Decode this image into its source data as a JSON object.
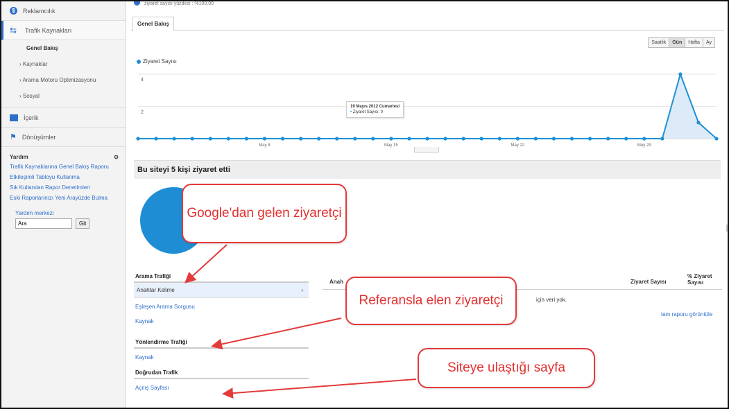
{
  "sidebar": {
    "items": [
      {
        "label": "Reklamcılık",
        "icon": "dollar-icon"
      },
      {
        "label": "Trafik Kaynakları",
        "icon": "traffic-arrows-icon"
      }
    ],
    "subitems": [
      "Genel Bakış",
      "› Kaynaklar",
      "› Arama Motoru Optimizasyonu",
      "› Sosyal"
    ],
    "items2": [
      {
        "label": "İçerik",
        "icon": "content-icon"
      },
      {
        "label": "Dönüşümler",
        "icon": "flag-icon"
      }
    ],
    "help": {
      "title": "Yardım",
      "toggle": "⊖",
      "links": [
        "Trafik Kaynaklarına Genel Bakış Raporu",
        "Etkileşimli Tabloyu Kullanma",
        "Sık Kullanılan Rapor Denetimleri",
        "Eski Raporlarınızı Yeni Arayüzde Bulma"
      ],
      "center_label": "Yardım merkezi",
      "search_value": "Ara",
      "go_label": "Git"
    }
  },
  "main": {
    "top_line": "ziyaret sayısı yüzdesi : %100,00",
    "tab": "Genel Bakış",
    "ranges": [
      "Saatlik",
      "Gün",
      "Hafta",
      "Ay"
    ],
    "selected_range": "Gün",
    "visitors_text": "Bu siteyi 5 kişi ziyaret etti",
    "tooltip": {
      "title": "19 Mayıs 2012 Cumartesi",
      "bullet": "•",
      "value": "Ziyaret Sayısı: 0"
    },
    "sections": {
      "search": {
        "title": "Arama Trafiği",
        "selected": "Anahtar Kelime",
        "chevron": "›",
        "links": [
          "Eşleşen Arama Sorgusu",
          "Kaynak"
        ]
      },
      "referral": {
        "title": "Yönlendirme Trafiği",
        "links": [
          "Kaynak"
        ]
      },
      "direct": {
        "title": "Doğrudan Trafik",
        "links": [
          "Açılış Sayfası"
        ]
      }
    },
    "table": {
      "col1": "Anah",
      "col2": "Ziyaret Sayısı",
      "col3": "% Ziyaret Sayısı",
      "no_data": "için veri yok.",
      "full_report": "tam raporu görüntüle"
    }
  },
  "callouts": {
    "google": "Google'dan gelen ziyaretçi",
    "referral": "Referansla elen ziyaretçi",
    "landing": "Siteye ulaştığı sayfa"
  },
  "colors": {
    "series": "#1d8fd6",
    "fill": "#dcebf7",
    "accent": "#2f6fc9",
    "callout": "#e33a3a"
  },
  "chart_data": {
    "type": "line",
    "legend": [
      "Ziyaret Sayısı"
    ],
    "ytick_labels": [
      "4",
      "2"
    ],
    "ylim": [
      0,
      4
    ],
    "xtick_labels": [
      "May 8",
      "May 15",
      "May 22",
      "May 29"
    ],
    "x": [
      "May 1",
      "May 2",
      "May 3",
      "May 4",
      "May 5",
      "May 6",
      "May 7",
      "May 8",
      "May 9",
      "May 10",
      "May 11",
      "May 12",
      "May 13",
      "May 14",
      "May 15",
      "May 16",
      "May 17",
      "May 18",
      "May 19",
      "May 20",
      "May 21",
      "May 22",
      "May 23",
      "May 24",
      "May 25",
      "May 26",
      "May 27",
      "May 28",
      "May 29",
      "May 30",
      "May 31",
      "Jun 1",
      "Jun 2"
    ],
    "series": [
      {
        "name": "Ziyaret Sayısı",
        "values": [
          0,
          0,
          0,
          0,
          0,
          0,
          0,
          0,
          0,
          0,
          0,
          0,
          0,
          0,
          0,
          0,
          0,
          0,
          0,
          0,
          0,
          0,
          0,
          0,
          0,
          0,
          0,
          0,
          0,
          0,
          4,
          1,
          0
        ]
      }
    ]
  }
}
